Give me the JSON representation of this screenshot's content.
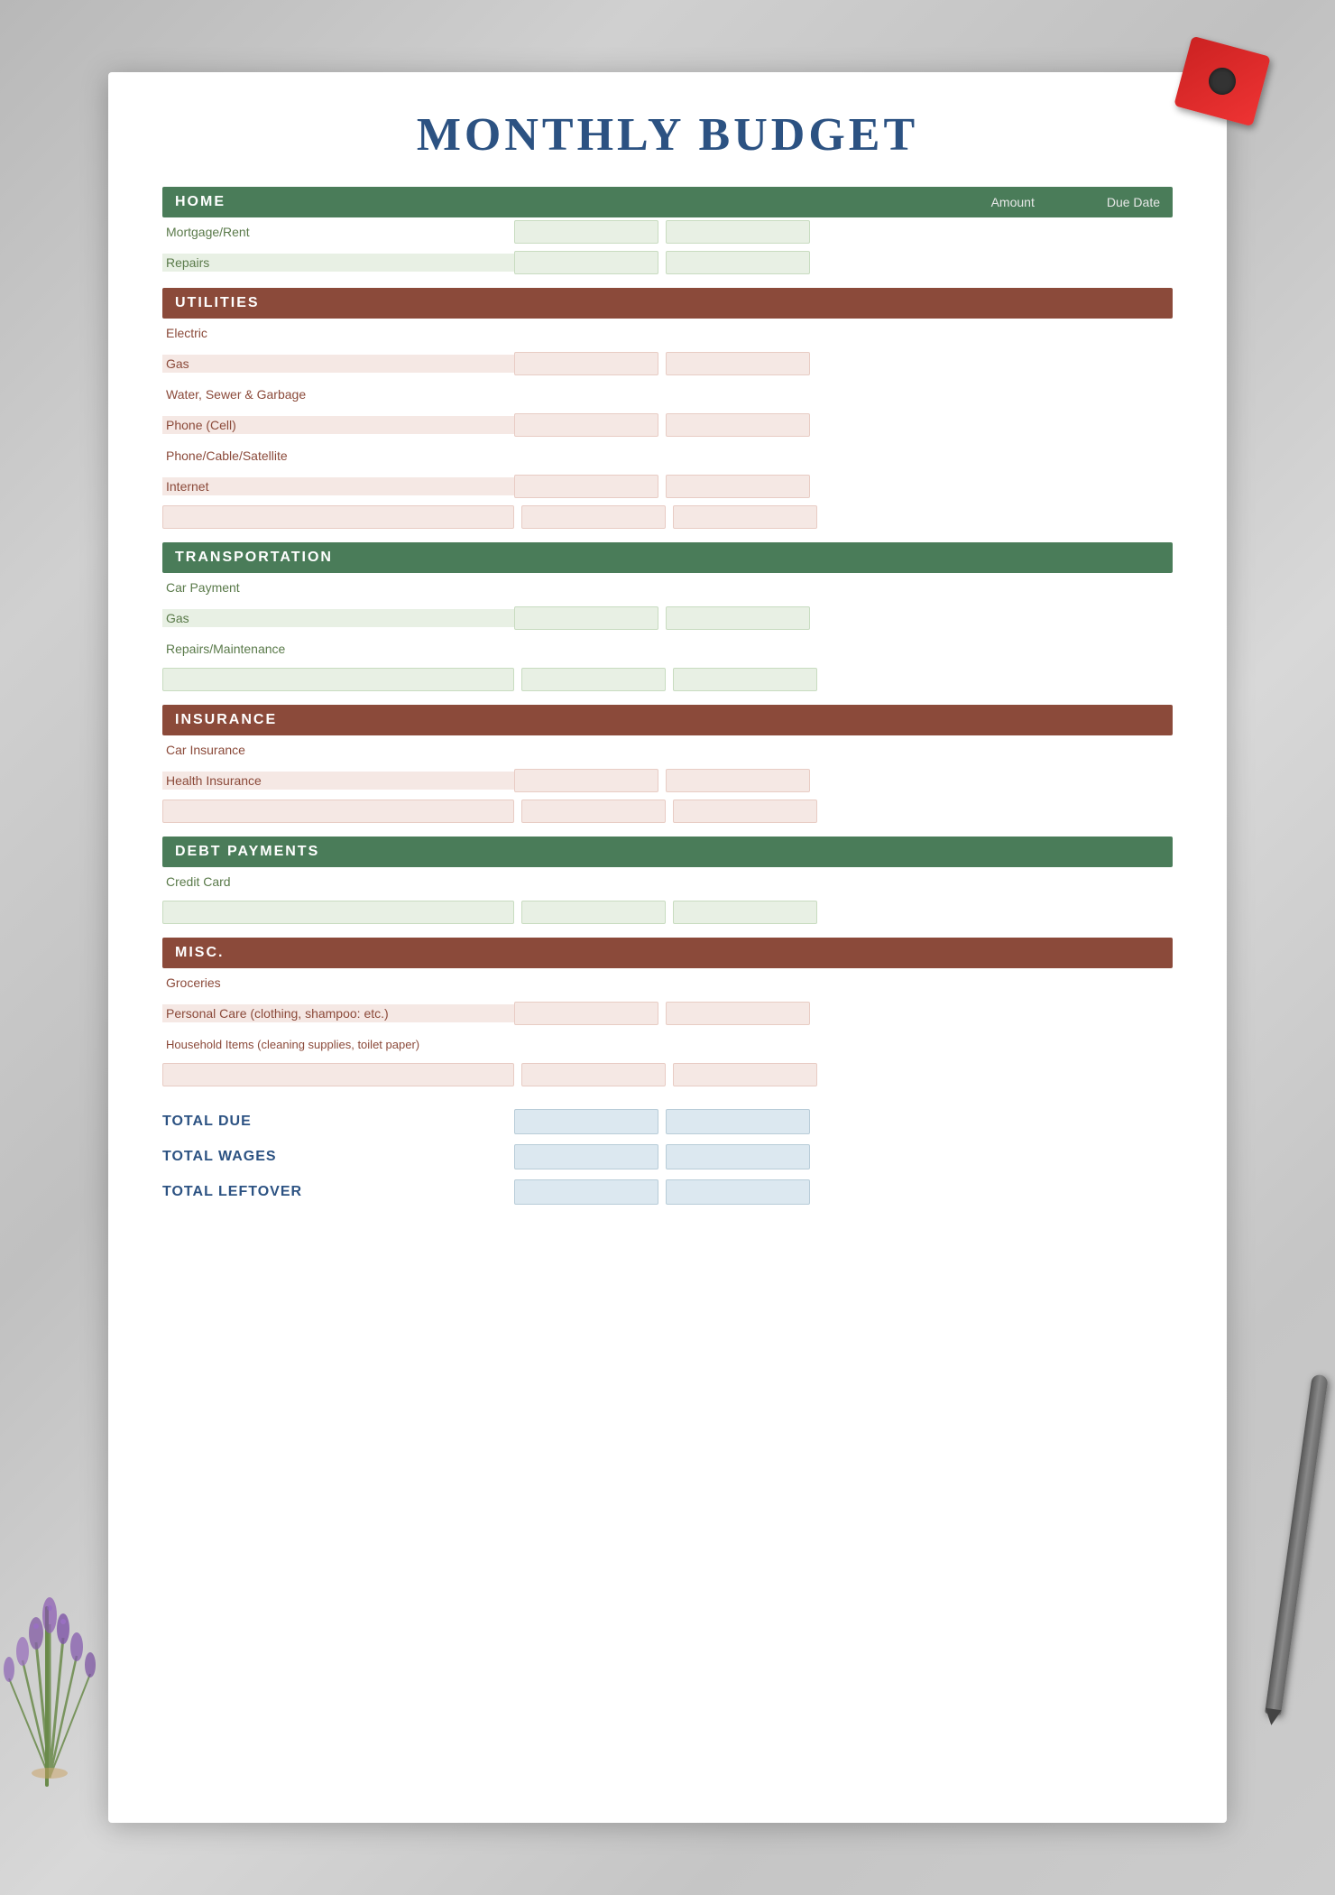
{
  "page": {
    "title": "MONTHLY BUDGET"
  },
  "columnHeaders": {
    "amount": "Amount",
    "dueDate": "Due Date"
  },
  "sections": [
    {
      "id": "home",
      "title": "HOME",
      "color": "green",
      "showColumnHeaders": true,
      "rows": [
        {
          "label": "Mortgage/Rent",
          "color": "green",
          "shaded": false
        },
        {
          "label": "Repairs",
          "color": "green",
          "shaded": true
        }
      ],
      "extraRows": 0
    },
    {
      "id": "utilities",
      "title": "UTILITIES",
      "color": "brown",
      "showColumnHeaders": false,
      "rows": [
        {
          "label": "Electric",
          "color": "brown",
          "shaded": false
        },
        {
          "label": "Gas",
          "color": "brown",
          "shaded": true
        },
        {
          "label": "Water, Sewer & Garbage",
          "color": "brown",
          "shaded": false
        },
        {
          "label": "Phone (Cell)",
          "color": "brown",
          "shaded": true
        },
        {
          "label": "Phone/Cable/Satellite",
          "color": "brown",
          "shaded": false
        },
        {
          "label": "Internet",
          "color": "brown",
          "shaded": true
        }
      ],
      "extraRows": 1
    },
    {
      "id": "transportation",
      "title": "TRANSPORTATION",
      "color": "green",
      "showColumnHeaders": false,
      "rows": [
        {
          "label": "Car Payment",
          "color": "green",
          "shaded": false
        },
        {
          "label": "Gas",
          "color": "green",
          "shaded": true
        },
        {
          "label": "Repairs/Maintenance",
          "color": "green",
          "shaded": false
        }
      ],
      "extraRows": 1
    },
    {
      "id": "insurance",
      "title": "INSURANCE",
      "color": "brown",
      "showColumnHeaders": false,
      "rows": [
        {
          "label": "Car Insurance",
          "color": "brown",
          "shaded": false
        },
        {
          "label": "Health Insurance",
          "color": "brown",
          "shaded": true
        }
      ],
      "extraRows": 1
    },
    {
      "id": "debt",
      "title": "DEBT PAYMENTS",
      "color": "green",
      "showColumnHeaders": false,
      "rows": [
        {
          "label": "Credit Card",
          "color": "green",
          "shaded": false
        }
      ],
      "extraRows": 1
    },
    {
      "id": "misc",
      "title": "MISC.",
      "color": "brown",
      "showColumnHeaders": false,
      "rows": [
        {
          "label": "Groceries",
          "color": "brown",
          "shaded": false
        },
        {
          "label": "Personal Care (clothing, shampoo: etc.)",
          "color": "brown",
          "shaded": true
        },
        {
          "label": "Household Items (cleaning supplies, toilet paper)",
          "color": "brown",
          "shaded": false
        }
      ],
      "extraRows": 1
    }
  ],
  "totals": [
    {
      "label": "TOTAL DUE",
      "color": "blue"
    },
    {
      "label": "TOTAL WAGES",
      "color": "blue"
    },
    {
      "label": "TOTAL LEFTOVER",
      "color": "blue"
    }
  ],
  "colors": {
    "green_header": "#4a7c59",
    "brown_header": "#8b4a3a",
    "green_text": "#5a7a4a",
    "brown_text": "#8b4a3a",
    "green_row": "#e8f0e4",
    "pink_row": "#f5e8e4",
    "blue_row": "#dce8f0",
    "title_color": "#2c5282"
  }
}
